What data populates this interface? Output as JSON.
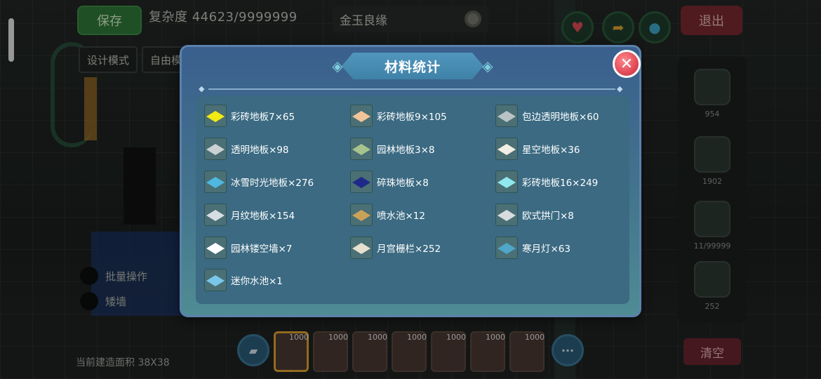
{
  "hud": {
    "save_label": "保存",
    "complexity": "复杂度 44623/9999999",
    "scene_name": "金玉良缘",
    "exit_label": "退出",
    "mode_design": "设计模式",
    "mode_free": "自由模",
    "batch_label": "批量操作",
    "low_wall_label": "矮墙",
    "area_label": "当前建造面积 38X38",
    "clear_label": "清空",
    "right_counts": [
      "954",
      "1902",
      "11/99999",
      "252"
    ],
    "slot_counts": [
      "1000",
      "1000",
      "1000",
      "1000",
      "1000",
      "1000",
      "1000"
    ],
    "more_label": "···"
  },
  "modal": {
    "title": "材料统计",
    "close_label": "✕",
    "items": [
      {
        "label": "彩砖地板7×65",
        "icon": "yellow-tile-icon",
        "color": "#f2ea13"
      },
      {
        "label": "彩砖地板9×105",
        "icon": "peach-tile-icon",
        "color": "#f2c49a"
      },
      {
        "label": "包边透明地板×60",
        "icon": "gray-tile-icon",
        "color": "#b9c3c6"
      },
      {
        "label": "透明地板×98",
        "icon": "gray-tile-icon",
        "color": "#c9d1d3"
      },
      {
        "label": "园林地板3×8",
        "icon": "garden-tile-icon",
        "color": "#a7c48e"
      },
      {
        "label": "星空地板×36",
        "icon": "white-tile-icon",
        "color": "#f3eee4"
      },
      {
        "label": "冰雪时光地板×276",
        "icon": "ice-tile-icon",
        "color": "#4fb8e0"
      },
      {
        "label": "碎珠地板×8",
        "icon": "starry-tile-icon",
        "color": "#1e2a8a"
      },
      {
        "label": "彩砖地板16×249",
        "icon": "cyan-tile-icon",
        "color": "#8fe8ee"
      },
      {
        "label": "月纹地板×154",
        "icon": "moon-tile-icon",
        "color": "#d6dde4"
      },
      {
        "label": "喷水池×12",
        "icon": "fountain-icon",
        "color": "#c9a25a"
      },
      {
        "label": "欧式拱门×8",
        "icon": "arch-door-icon",
        "color": "#d8dcdf"
      },
      {
        "label": "园林镂空墙×7",
        "icon": "hollow-wall-icon",
        "color": "#ffffff"
      },
      {
        "label": "月宫栅栏×252",
        "icon": "fence-icon",
        "color": "#e6e0cf"
      },
      {
        "label": "寒月灯×63",
        "icon": "lamp-icon",
        "color": "#4fa6c9"
      },
      {
        "label": "迷你水池×1",
        "icon": "mini-pool-icon",
        "color": "#78c6ea"
      }
    ]
  }
}
